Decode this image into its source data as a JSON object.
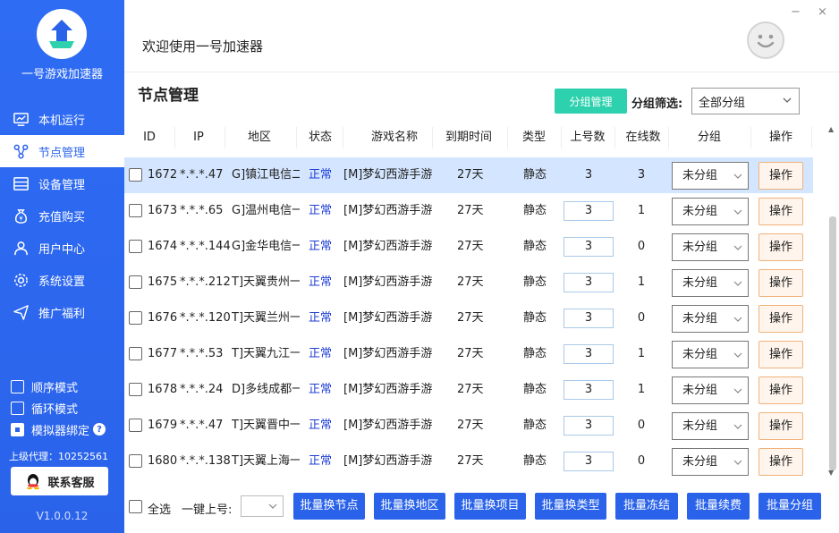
{
  "sidebar": {
    "app_name": "一号游戏加速器",
    "nav": [
      "本机运行",
      "节点管理",
      "设备管理",
      "充值购买",
      "用户中心",
      "系统设置",
      "推广福利"
    ],
    "options": [
      "顺序模式",
      "循环模式",
      "模拟器绑定"
    ],
    "agent": "上级代理：10252561",
    "service": "联系客服",
    "version": "V1.0.0.12"
  },
  "header": {
    "welcome": "欢迎使用一号加速器",
    "minimize": "−",
    "close": "×"
  },
  "page": {
    "title": "节点管理",
    "group_manage": "分组管理",
    "filter_label": "分组筛选:",
    "filter_value": "全部分组"
  },
  "table": {
    "headers": [
      "ID",
      "IP",
      "地区",
      "状态",
      "游戏名称",
      "到期时间",
      "类型",
      "上号数",
      "在线数",
      "分组",
      "操作"
    ],
    "rows": [
      {
        "id": "1672",
        "ip": "*.*.*.47",
        "region": "G]镇江电信二组",
        "status": "正常",
        "game": "[M]梦幻西游手游",
        "expire": "27天",
        "type": "静态",
        "up": "3",
        "online": "3",
        "group": "未分组",
        "op": "操作"
      },
      {
        "id": "1673",
        "ip": "*.*.*.65",
        "region": "G]温州电信一组",
        "status": "正常",
        "game": "[M]梦幻西游手游",
        "expire": "27天",
        "type": "静态",
        "up": "3",
        "online": "1",
        "group": "未分组",
        "op": "操作"
      },
      {
        "id": "1674",
        "ip": "*.*.*.144",
        "region": "G]金华电信一区",
        "status": "正常",
        "game": "[M]梦幻西游手游",
        "expire": "27天",
        "type": "静态",
        "up": "3",
        "online": "0",
        "group": "未分组",
        "op": "操作"
      },
      {
        "id": "1675",
        "ip": "*.*.*.212",
        "region": "T]天翼贵州一组",
        "status": "正常",
        "game": "[M]梦幻西游手游",
        "expire": "27天",
        "type": "静态",
        "up": "3",
        "online": "1",
        "group": "未分组",
        "op": "操作"
      },
      {
        "id": "1676",
        "ip": "*.*.*.120",
        "region": "T]天翼兰州一组",
        "status": "正常",
        "game": "[M]梦幻西游手游",
        "expire": "27天",
        "type": "静态",
        "up": "3",
        "online": "0",
        "group": "未分组",
        "op": "操作"
      },
      {
        "id": "1677",
        "ip": "*.*.*.53",
        "region": "T]天翼九江一组",
        "status": "正常",
        "game": "[M]梦幻西游手游",
        "expire": "27天",
        "type": "静态",
        "up": "3",
        "online": "1",
        "group": "未分组",
        "op": "操作"
      },
      {
        "id": "1678",
        "ip": "*.*.*.24",
        "region": "D]多线成都一组",
        "status": "正常",
        "game": "[M]梦幻西游手游",
        "expire": "27天",
        "type": "静态",
        "up": "3",
        "online": "1",
        "group": "未分组",
        "op": "操作"
      },
      {
        "id": "1679",
        "ip": "*.*.*.47",
        "region": "T]天翼晋中一区",
        "status": "正常",
        "game": "[M]梦幻西游手游",
        "expire": "27天",
        "type": "静态",
        "up": "3",
        "online": "0",
        "group": "未分组",
        "op": "操作"
      },
      {
        "id": "1680",
        "ip": "*.*.*.138",
        "region": "T]天翼上海一区",
        "status": "正常",
        "game": "[M]梦幻西游手游",
        "expire": "27天",
        "type": "静态",
        "up": "3",
        "online": "0",
        "group": "未分组",
        "op": "操作"
      }
    ]
  },
  "footer": {
    "select_all": "全选",
    "onekey": "一键上号:",
    "buttons": [
      "批量换节点",
      "批量换地区",
      "批量换项目",
      "批量换类型",
      "批量冻结",
      "批量续费",
      "批量分组"
    ]
  },
  "colors": {
    "sidebar": "#2a63ea",
    "accent": "#2ed1ae",
    "selected_row": "#d4e6ff",
    "op_border": "#f0b27a"
  }
}
